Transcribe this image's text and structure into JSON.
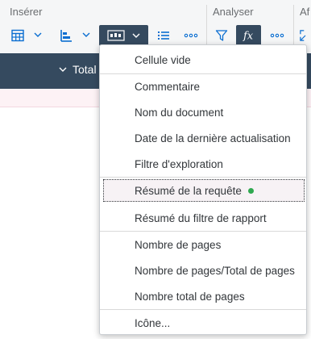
{
  "ribbon": {
    "insert_label": "Insérer",
    "analyze_label": "Analyser",
    "display_label": "Af"
  },
  "table": {
    "header_partial": "Total"
  },
  "menu": {
    "items": [
      {
        "label": "Cellule vide"
      },
      {
        "label": "Commentaire"
      },
      {
        "label": "Nom du document"
      },
      {
        "label": "Date de la dernière actualisation"
      },
      {
        "label": "Filtre d'exploration"
      },
      {
        "label": "Résumé de la requête",
        "status": "green-dot"
      },
      {
        "label": "Résumé du filtre de rapport"
      },
      {
        "label": "Nombre de pages"
      },
      {
        "label": "Nombre de pages/Total de pages"
      },
      {
        "label": "Nombre total de pages"
      },
      {
        "label": "Icône..."
      }
    ]
  },
  "colors": {
    "toolbar_icon": "#0a6ed1",
    "active_button_bg": "#354a5f",
    "table_header_bg": "#354a5f",
    "status_dot": "#2fa84f"
  }
}
